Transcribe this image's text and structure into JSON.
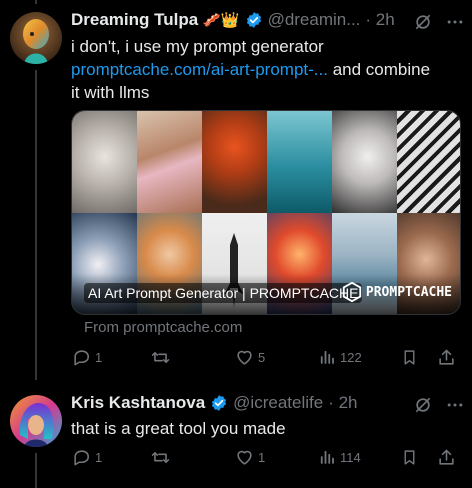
{
  "tweets": [
    {
      "name": "Dreaming Tulpa",
      "emojis": "🥓👑",
      "handle": "@dreamin...",
      "time": "· 2h",
      "text_start": "i don't, i use my prompt generator",
      "link_text": "promptcache.com/ai-art-prompt-...",
      "text_end_inline": " and combine",
      "text_end_line": "it with llms",
      "card": {
        "title": "AI Art Prompt Generator | PROMPTCACHE",
        "logo_text": "PROMPTCACHE",
        "from": "From promptcache.com"
      },
      "stats": {
        "replies": "1",
        "retweets": "",
        "likes": "5",
        "views": "122"
      }
    },
    {
      "name": "Kris Kashtanova",
      "handle": "@icreatelife",
      "time": "· 2h",
      "text": "that is a great tool you made",
      "stats": {
        "replies": "1",
        "retweets": "",
        "likes": "1",
        "views": "114"
      }
    }
  ],
  "colors": {
    "background": "#000000",
    "text": "#e7e9ea",
    "muted": "#71767b",
    "link": "#1d9bf0",
    "verified": "#1d9bf0"
  },
  "icons": [
    "verified-badge-icon",
    "grok-icon",
    "more-icon",
    "reply-icon",
    "retweet-icon",
    "like-icon",
    "views-icon",
    "bookmark-icon",
    "share-icon"
  ]
}
